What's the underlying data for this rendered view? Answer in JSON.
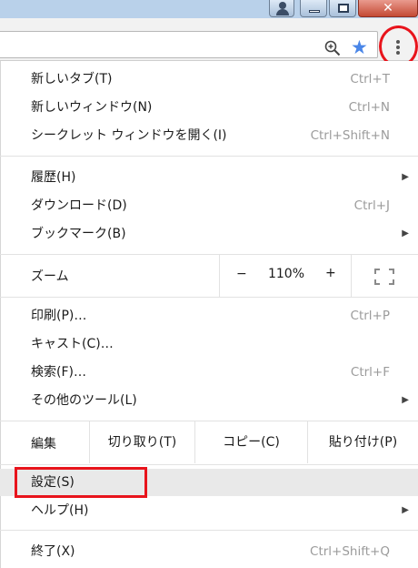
{
  "window": {
    "close_glyph": "✕"
  },
  "toolbar": {
    "zoom_icon": "magnifier-plus",
    "star_icon": "star",
    "star_color": "#4a86e8",
    "menu_icon": "vertical-ellipsis",
    "highlight_color": "#e8141c"
  },
  "menu": {
    "new_tab": {
      "label": "新しいタブ(T)",
      "shortcut": "Ctrl+T"
    },
    "new_window": {
      "label": "新しいウィンドウ(N)",
      "shortcut": "Ctrl+N"
    },
    "incognito": {
      "label": "シークレット ウィンドウを開く(I)",
      "shortcut": "Ctrl+Shift+N"
    },
    "history": {
      "label": "履歴(H)"
    },
    "downloads": {
      "label": "ダウンロード(D)",
      "shortcut": "Ctrl+J"
    },
    "bookmarks": {
      "label": "ブックマーク(B)"
    },
    "zoom": {
      "label": "ズーム",
      "minus": "−",
      "value": "110%",
      "plus": "+"
    },
    "print": {
      "label": "印刷(P)…",
      "shortcut": "Ctrl+P"
    },
    "cast": {
      "label": "キャスト(C)…"
    },
    "find": {
      "label": "検索(F)…",
      "shortcut": "Ctrl+F"
    },
    "more_tools": {
      "label": "その他のツール(L)"
    },
    "edit": {
      "label": "編集",
      "cut": "切り取り(T)",
      "copy": "コピー(C)",
      "paste": "貼り付け(P)"
    },
    "settings": {
      "label": "設定(S)"
    },
    "help": {
      "label": "ヘルプ(H)"
    },
    "exit": {
      "label": "終了(X)",
      "shortcut": "Ctrl+Shift+Q"
    },
    "submenu_arrow": "▶"
  }
}
